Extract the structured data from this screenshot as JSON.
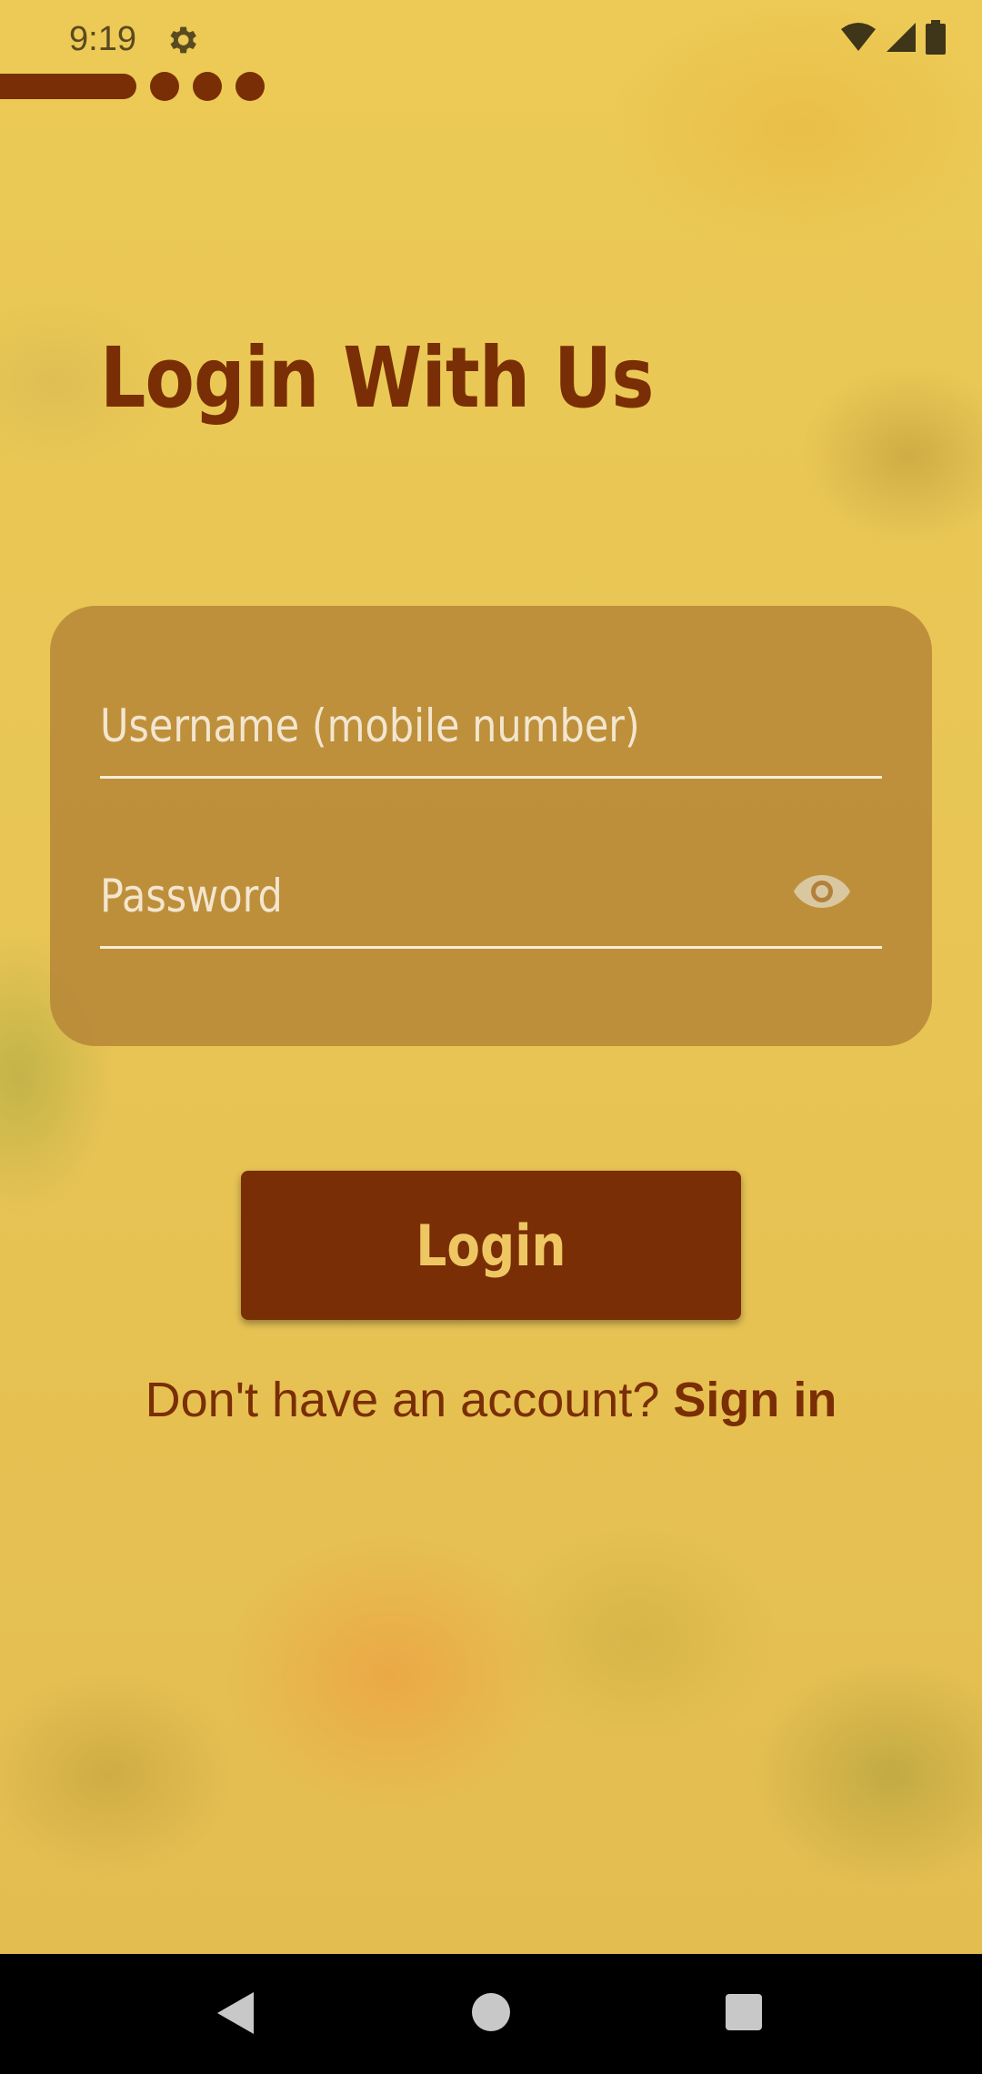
{
  "status_bar": {
    "time": "9:19",
    "icons": [
      "gear-icon",
      "wifi-icon",
      "signal-icon",
      "battery-icon"
    ]
  },
  "progress": {
    "filled_steps": 1,
    "remaining_dots": 3
  },
  "page": {
    "title": "Login With Us"
  },
  "form": {
    "username_placeholder": "Username (mobile number)",
    "username_value": "",
    "password_placeholder": "Password",
    "password_value": "",
    "eye_icon": "eye-icon"
  },
  "actions": {
    "login_label": "Login",
    "no_account_text": "Don't have an account?",
    "signin_label": "Sign in"
  },
  "nav_bar": {
    "icons": [
      "back-icon",
      "home-icon",
      "recents-icon"
    ]
  },
  "colors": {
    "brand_dark": "#7a2e05",
    "background": "#e9c451",
    "card": "#b2803a",
    "button_text": "#eec763"
  }
}
